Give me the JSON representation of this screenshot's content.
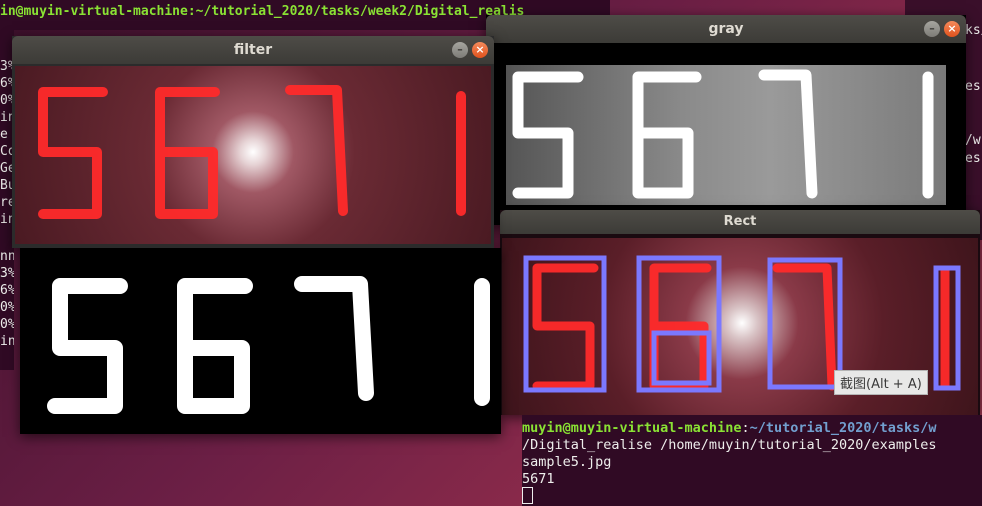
{
  "terminal_top": {
    "partial_line": "in@muyin-virtual-machine:~/tutorial_2020/tasks/week2/Digital_realis"
  },
  "terminal_left": {
    "lines": [
      "3%",
      "6%",
      "0%",
      "in",
      "e",
      "Co",
      "Ge",
      "Bu",
      "re",
      "in"
    ],
    "lines2": [
      "nn",
      "3%",
      "6%",
      "0%",
      "0%",
      "in"
    ]
  },
  "terminal_right": {
    "fragments": [
      "ks/",
      "es",
      "/w",
      "es"
    ]
  },
  "windows": {
    "filter": {
      "title": "filter"
    },
    "gray": {
      "title": "gray"
    },
    "rect": {
      "title": "Rect"
    },
    "thresh": {
      "title": ""
    }
  },
  "display_digits": "5671",
  "tooltip": {
    "text": "截图(Alt + A)"
  },
  "terminal_bottom": {
    "user_host": "muyin@muyin-virtual-machine",
    "path": "~/tutorial_2020/tasks/w",
    "line2": "/Digital_realise /home/muyin/tutorial_2020/examples",
    "line3": "sample5.jpg",
    "line4": "5671"
  },
  "colors": {
    "segment_red": "#ff2a2a",
    "rect_box": "#7b78ff",
    "terminal_bg": "#300a24"
  }
}
